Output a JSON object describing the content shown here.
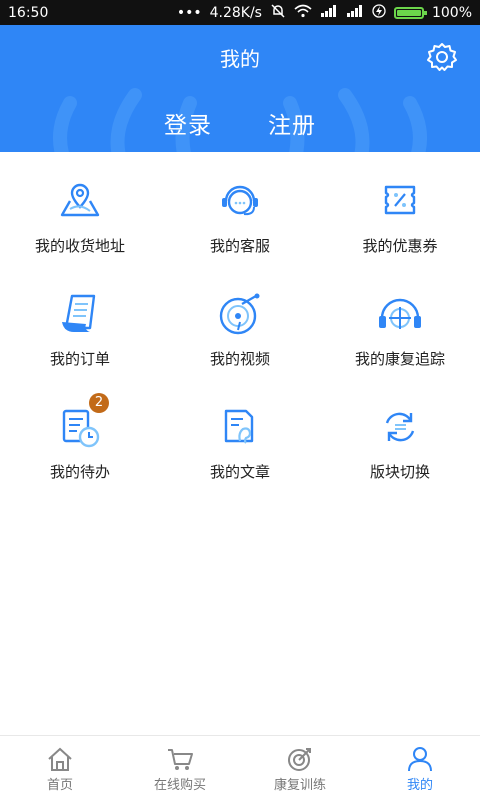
{
  "status_bar": {
    "time": "16:50",
    "dots": "•••",
    "speed": "4.28K/s",
    "battery_percent": "100%",
    "battery_level": 1.0
  },
  "header": {
    "title": "我的",
    "login_label": "登录",
    "register_label": "注册",
    "settings_icon": "gear-icon",
    "accent_color": "#2f86f6"
  },
  "menu": {
    "rows": [
      [
        {
          "label": "我的收货地址",
          "icon": "map-pin-icon"
        },
        {
          "label": "我的客服",
          "icon": "headset-icon"
        },
        {
          "label": "我的优惠券",
          "icon": "coupon-icon"
        }
      ],
      [
        {
          "label": "我的订单",
          "icon": "document-scroll-icon"
        },
        {
          "label": "我的视频",
          "icon": "video-disc-icon"
        },
        {
          "label": "我的康复追踪",
          "icon": "target-headphones-icon"
        }
      ],
      [
        {
          "label": "我的待办",
          "icon": "todo-clock-icon",
          "badge": "2"
        },
        {
          "label": "我的文章",
          "icon": "article-ear-icon"
        },
        {
          "label": "版块切换",
          "icon": "switch-icon"
        }
      ]
    ]
  },
  "tabbar": {
    "tabs": [
      {
        "label": "首页",
        "icon": "home-icon",
        "active": false
      },
      {
        "label": "在线购买",
        "icon": "cart-icon",
        "active": false
      },
      {
        "label": "康复训练",
        "icon": "training-target-icon",
        "active": false
      },
      {
        "label": "我的",
        "icon": "user-icon",
        "active": true
      }
    ]
  }
}
